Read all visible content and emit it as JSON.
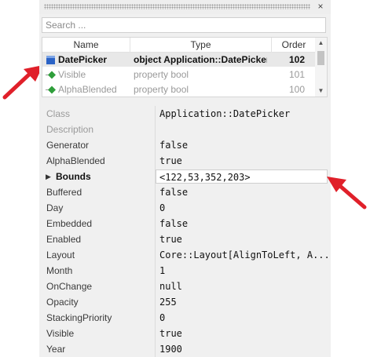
{
  "colors": {
    "arrow": "#e0202a",
    "icon_green": "#2e9e3a",
    "icon_blue": "#2b63c6"
  },
  "panel": {
    "close_icon": "×",
    "search": {
      "placeholder": "Search ...",
      "value": ""
    }
  },
  "tree": {
    "columns": {
      "name": "Name",
      "type": "Type",
      "order": "Order"
    },
    "rows": [
      {
        "name": "DatePicker",
        "type": "object Application::DatePicker",
        "order": "102",
        "icon": "object-icon"
      },
      {
        "name": "Visible",
        "type": "property bool",
        "order": "101",
        "icon": "property-icon"
      },
      {
        "name": "AlphaBlended",
        "type": "property bool",
        "order": "100",
        "icon": "property-icon"
      }
    ]
  },
  "properties": [
    {
      "label": "Class",
      "value": "Application::DatePicker"
    },
    {
      "label": "Description",
      "value": ""
    },
    {
      "label": "Generator",
      "value": "false"
    },
    {
      "label": "AlphaBlended",
      "value": "true"
    },
    {
      "label": "Bounds",
      "value": "<122,53,352,203>"
    },
    {
      "label": "Buffered",
      "value": "false"
    },
    {
      "label": "Day",
      "value": "0"
    },
    {
      "label": "Embedded",
      "value": "false"
    },
    {
      "label": "Enabled",
      "value": "true"
    },
    {
      "label": "Layout",
      "value": "Core::Layout[AlignToLeft, A..."
    },
    {
      "label": "Month",
      "value": "1"
    },
    {
      "label": "OnChange",
      "value": "null"
    },
    {
      "label": "Opacity",
      "value": "255"
    },
    {
      "label": "StackingPriority",
      "value": "0"
    },
    {
      "label": "Visible",
      "value": "true"
    },
    {
      "label": "Year",
      "value": "1900"
    }
  ]
}
